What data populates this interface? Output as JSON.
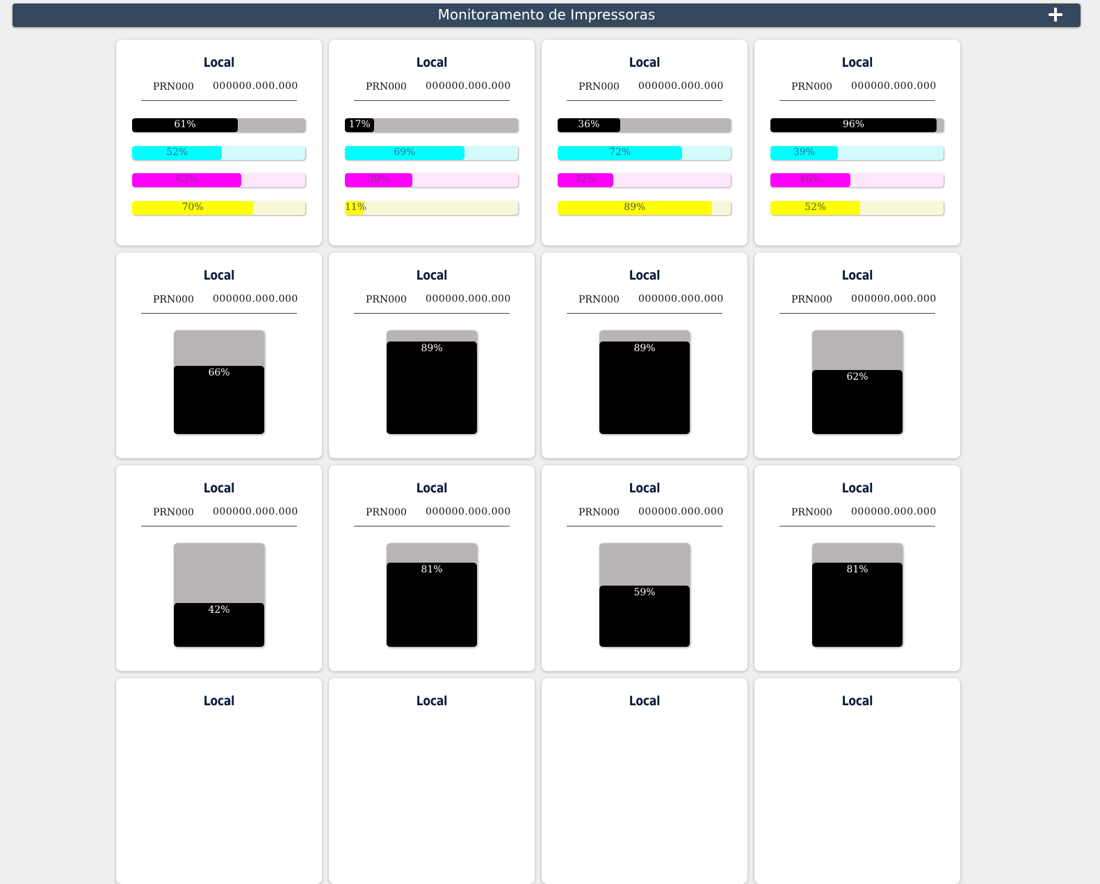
{
  "header": {
    "title": "Monitoramento de Impressoras",
    "add_icon": "plus-icon"
  },
  "colors": {
    "header": "#34495e",
    "black": "#000000",
    "cyan": "#00ffff",
    "magenta": "#ff00ff",
    "yellow": "#ffff00"
  },
  "printers": [
    {
      "local": "Local",
      "name": "PRN000",
      "ip": "000000.000.000",
      "type": "color",
      "levels": [
        {
          "ink": "k",
          "value": 61,
          "label": "61%"
        },
        {
          "ink": "c",
          "value": 52,
          "label": "52%"
        },
        {
          "ink": "m",
          "value": 63,
          "label": "63%"
        },
        {
          "ink": "y",
          "value": 70,
          "label": "70%"
        }
      ]
    },
    {
      "local": "Local",
      "name": "PRN000",
      "ip": "000000.000.000",
      "type": "color",
      "levels": [
        {
          "ink": "k",
          "value": 17,
          "label": "17%"
        },
        {
          "ink": "c",
          "value": 69,
          "label": "69%"
        },
        {
          "ink": "m",
          "value": 39,
          "label": "39%"
        },
        {
          "ink": "y",
          "value": 11,
          "label": "11%"
        }
      ]
    },
    {
      "local": "Local",
      "name": "PRN000",
      "ip": "000000.000.000",
      "type": "color",
      "levels": [
        {
          "ink": "k",
          "value": 36,
          "label": "36%"
        },
        {
          "ink": "c",
          "value": 72,
          "label": "72%"
        },
        {
          "ink": "m",
          "value": 32,
          "label": "32%"
        },
        {
          "ink": "y",
          "value": 89,
          "label": "89%"
        }
      ]
    },
    {
      "local": "Local",
      "name": "PRN000",
      "ip": "000000.000.000",
      "type": "color",
      "levels": [
        {
          "ink": "k",
          "value": 96,
          "label": "96%"
        },
        {
          "ink": "c",
          "value": 39,
          "label": "39%"
        },
        {
          "ink": "m",
          "value": 46,
          "label": "46%"
        },
        {
          "ink": "y",
          "value": 52,
          "label": "52%"
        }
      ]
    },
    {
      "local": "Local",
      "name": "PRN000",
      "ip": "000000.000.000",
      "type": "mono",
      "value": 66,
      "label": "66%"
    },
    {
      "local": "Local",
      "name": "PRN000",
      "ip": "000000.000.000",
      "type": "mono",
      "value": 89,
      "label": "89%"
    },
    {
      "local": "Local",
      "name": "PRN000",
      "ip": "000000.000.000",
      "type": "mono",
      "value": 89,
      "label": "89%"
    },
    {
      "local": "Local",
      "name": "PRN000",
      "ip": "000000.000.000",
      "type": "mono",
      "value": 62,
      "label": "62%"
    },
    {
      "local": "Local",
      "name": "PRN000",
      "ip": "000000.000.000",
      "type": "mono",
      "value": 42,
      "label": "42%"
    },
    {
      "local": "Local",
      "name": "PRN000",
      "ip": "000000.000.000",
      "type": "mono",
      "value": 81,
      "label": "81%"
    },
    {
      "local": "Local",
      "name": "PRN000",
      "ip": "000000.000.000",
      "type": "mono",
      "value": 59,
      "label": "59%"
    },
    {
      "local": "Local",
      "name": "PRN000",
      "ip": "000000.000.000",
      "type": "mono",
      "value": 81,
      "label": "81%"
    },
    {
      "local": "Local",
      "type": "partial"
    },
    {
      "local": "Local",
      "type": "partial"
    },
    {
      "local": "Local",
      "type": "partial"
    },
    {
      "local": "Local",
      "type": "partial"
    }
  ]
}
